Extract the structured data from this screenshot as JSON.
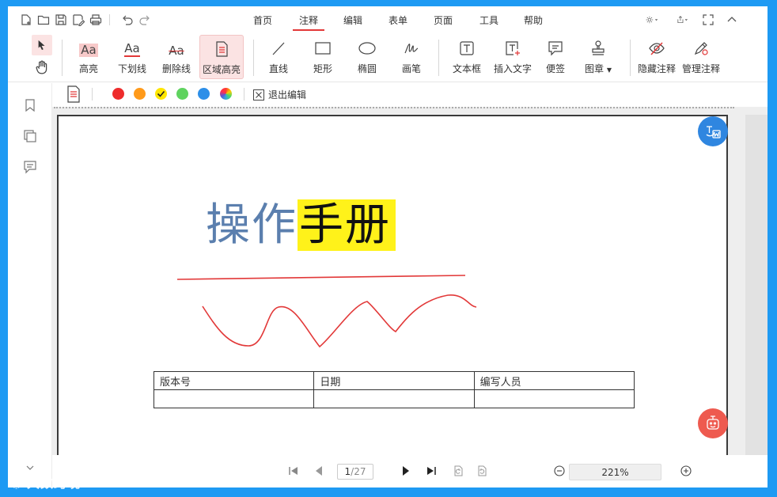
{
  "menu": {
    "tabs": [
      {
        "label": "首页"
      },
      {
        "label": "注释",
        "active": true
      },
      {
        "label": "编辑"
      },
      {
        "label": "表单"
      },
      {
        "label": "页面"
      },
      {
        "label": "工具"
      },
      {
        "label": "帮助"
      }
    ]
  },
  "ribbon": {
    "highlight": "高亮",
    "underline": "下划线",
    "strikethrough": "删除线",
    "area_highlight": "区域高亮",
    "line": "直线",
    "rectangle": "矩形",
    "ellipse": "椭圆",
    "pen": "画笔",
    "textbox": "文本框",
    "insert_text": "插入文字",
    "sticky_note": "便签",
    "stamp": "图章",
    "hide_annotations": "隐藏注释",
    "manage_annotations": "管理注释",
    "aa_glyph": "Aa"
  },
  "subbar": {
    "colors": [
      "#ee2c2c",
      "#ff9a1a",
      "#ffe600",
      "#5fd35f",
      "#2d8fe8"
    ],
    "selected_color": "#ffe600",
    "exit_label": "退出编辑"
  },
  "document": {
    "title_part1": "操作",
    "title_part2": "手册",
    "table_headers": [
      "版本号",
      "日期",
      "编写人员"
    ],
    "highlight_color": "#fff21a",
    "ink_color": "#e23838"
  },
  "status": {
    "current_page": "1",
    "total_pages": "/27",
    "zoom": "221%"
  },
  "watermark": "大数跨境",
  "colors": {
    "frame": "#1e9af3",
    "accent_red": "#e23838",
    "fab_blue": "#2f86e0",
    "fab_red": "#ee5a4f"
  }
}
